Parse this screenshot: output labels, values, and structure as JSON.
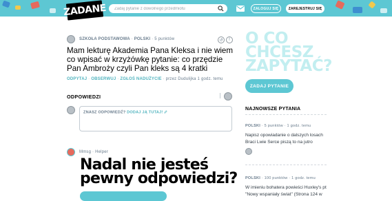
{
  "header": {
    "logo": "ZADANE",
    "search_placeholder": "Zadaj pytanie z dowolnego przedmiotu",
    "login_label": "ZALOGUJ SIĘ",
    "register_label": "ZAREJESTRUJ SIĘ",
    "icons": [
      "search-icon",
      "mail-icon"
    ]
  },
  "question": {
    "level": "SZKOŁA PODSTAWOWA",
    "subject": "POLSKI",
    "points": "5 punktów",
    "text": "Mam lekturę Akademia Pana Kleksa i nie wiem co wpisać w krzyżówkę pytanie: co przędzie Pan Ambroży czyli Pan kleks są 4 kratki",
    "links": [
      "ODPYTAJ",
      "OBSERWUJ",
      "ZGŁOŚ NADUŻYCIE"
    ],
    "asked_by": "przez Dudulijka 1 godz. temu"
  },
  "answers": {
    "heading": "ODPOWIEDZI",
    "prompt": "ZNASZ ODPOWIEDŹ?",
    "add_label": "DODAJ JĄ TUTAJ!"
  },
  "promo": {
    "user": "Mmsg",
    "role": "Helper",
    "headline": "Nadal nie jesteś pewny odpowiedzi?"
  },
  "sidebar": {
    "big_question": "O CO CHCESZ ZAPYTAĆ?",
    "ask_button": "ZADAJ PYTANIE",
    "newest_heading": "NAJNOWSZE PYTANIA",
    "items": [
      {
        "subject": "POLSKI",
        "points": "5 punktów",
        "time": "1 godz. temu",
        "text": "Napisz opowiadanie o dalszych losach Braci Lwie Serce piszą to na jutro"
      },
      {
        "subject": "POLSKI",
        "points": "100 punktów",
        "time": "1 godz. temu",
        "text": "W imieniu bohatera powieści Huxley's pt \"Nowy wspaniały świat\" (Strona 124 w"
      }
    ]
  },
  "colors": {
    "accent": "#5dc7d3",
    "link": "#4fb3be",
    "big_question": "#c2eef0"
  }
}
